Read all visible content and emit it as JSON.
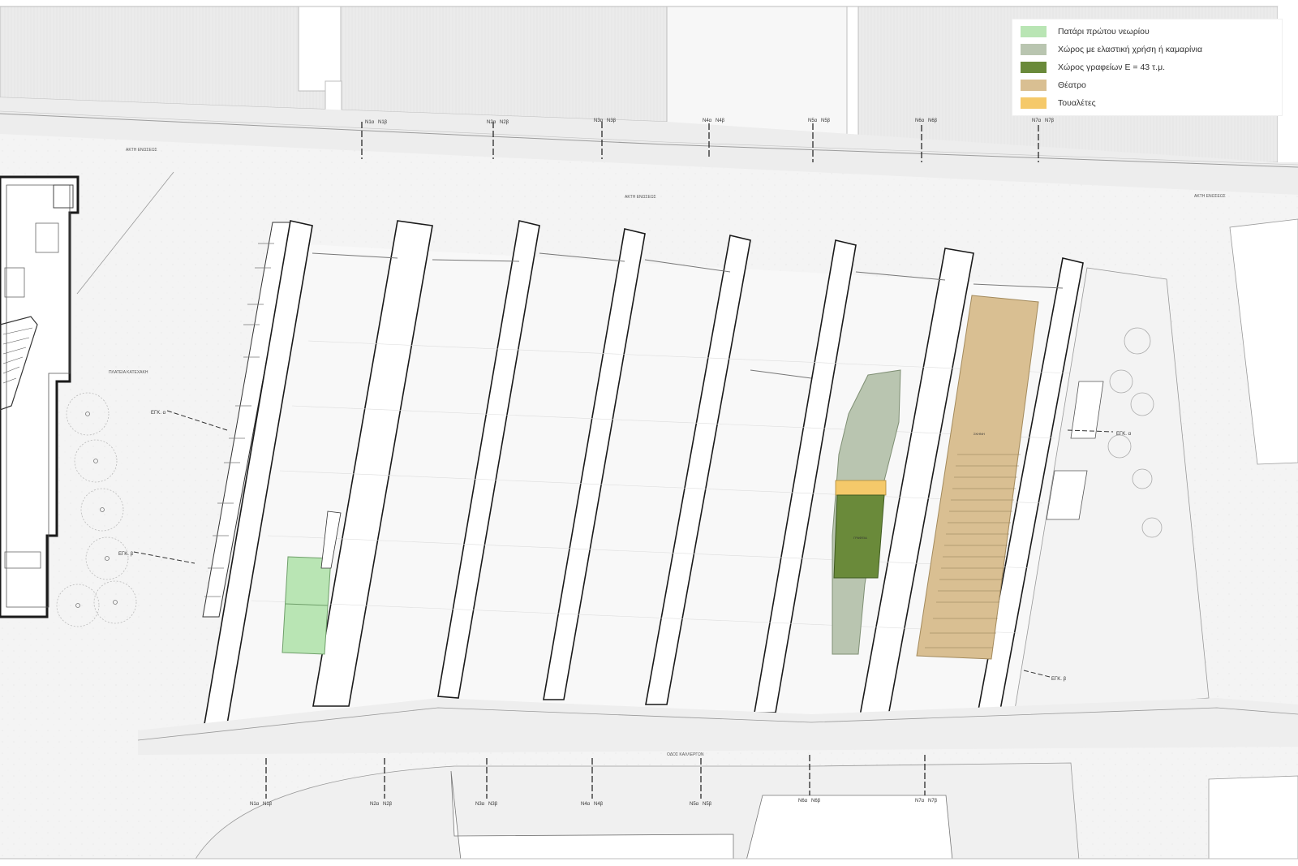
{
  "legend": {
    "items": [
      {
        "label": "Πατάρι πρώτου νεωρίου",
        "color": "#b9e5b4"
      },
      {
        "label": "Χώρος με ελαστική χρήση ή καμαρίνια",
        "color": "#b9c5b0"
      },
      {
        "label": "Χώρος γραφείων Ε = 43 τ.μ.",
        "color": "#6a8a3a"
      },
      {
        "label": "Θέατρο",
        "color": "#d9bf92"
      },
      {
        "label": "Τουαλέτες",
        "color": "#f5c96a"
      }
    ]
  },
  "labels": {
    "street_north_left": "ΑΚΤΗ ΕΝΩΣΕΩΣ",
    "street_north_center": "ΑΚΤΗ ΕΝΩΣΕΩΣ",
    "street_north_right": "ΑΚΤΗ ΕΝΩΣΕΩΣ",
    "square": "ΠΛΑΤΕΙΑ ΚΑΤΕΧΑΚΗ",
    "street_south": "ΟΔΟΣ ΚΑΛΛΕΡΓΩΝ",
    "entrance_a": "ΕΓΚ. α",
    "entrance_b": "ΕΓΚ. β",
    "entrance_c": "ΕΓΚ. α",
    "entrance_d": "ΕΓΚ. β"
  },
  "sections": {
    "north": [
      {
        "a": "N1α",
        "b": "N1β"
      },
      {
        "a": "N2α",
        "b": "N2β"
      },
      {
        "a": "N3α",
        "b": "N3β"
      },
      {
        "a": "N4α",
        "b": "N4β"
      },
      {
        "a": "N5α",
        "b": "N5β"
      },
      {
        "a": "N6α",
        "b": "N6β"
      },
      {
        "a": "N7α",
        "b": "N7β"
      }
    ],
    "south": [
      {
        "a": "N1α",
        "b": "N1β"
      },
      {
        "a": "N2α",
        "b": "N2β"
      },
      {
        "a": "N3α",
        "b": "N3β"
      },
      {
        "a": "N4α",
        "b": "N4β"
      },
      {
        "a": "N5α",
        "b": "N5β"
      },
      {
        "a": "N6α",
        "b": "N6β"
      },
      {
        "a": "N7α",
        "b": "N7β"
      }
    ]
  },
  "rooms": {
    "office_label": "ΓΡΑΦΕΙΑ",
    "stage_label": "ΣΚΗΝΗ"
  },
  "colors": {
    "line": "#1a1a1a",
    "ground": "#f1f1f1",
    "quay": "#e9e9e9",
    "hall_floor": "#f7f7f7"
  }
}
